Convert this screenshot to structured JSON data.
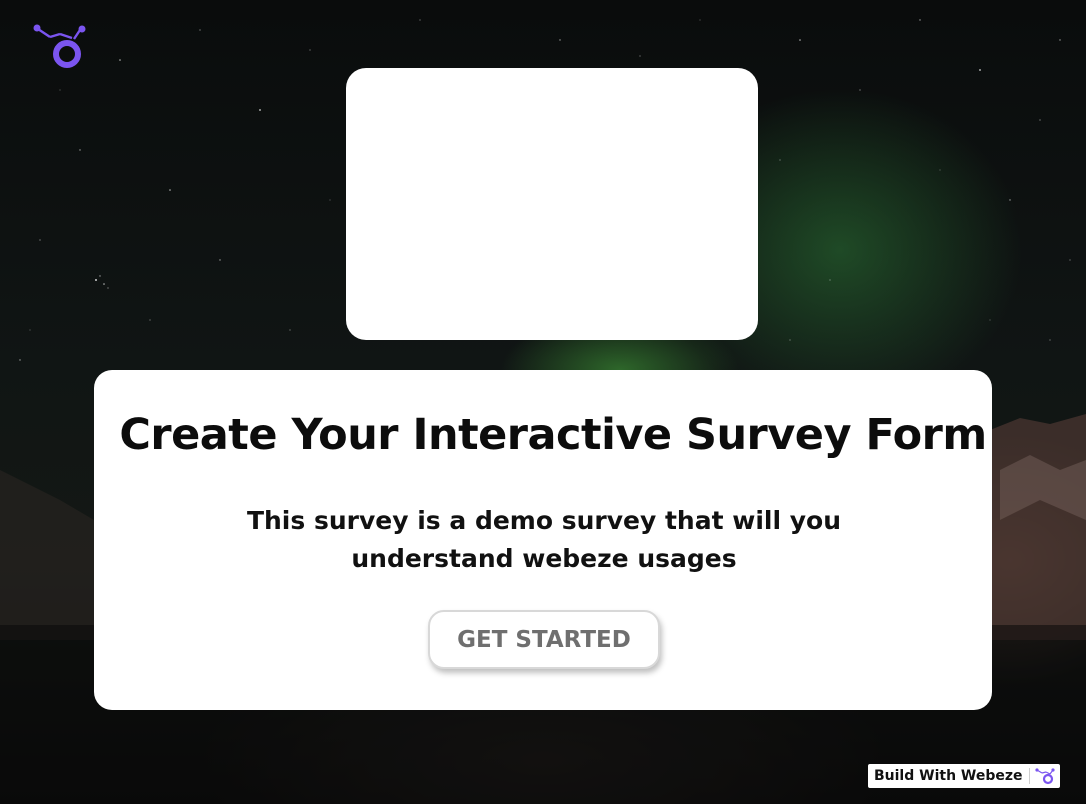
{
  "brand": {
    "logo_icon": "webeze-logo-icon",
    "accent_color": "#7b55f0"
  },
  "hero": {
    "title": "Create Your Interactive Survey Form",
    "subtitle": "This survey is a demo survey that will you understand webeze usages",
    "cta_label": "GET STARTED"
  },
  "footer_badge": {
    "label": "Build With Webeze",
    "icon": "webeze-logo-icon"
  }
}
